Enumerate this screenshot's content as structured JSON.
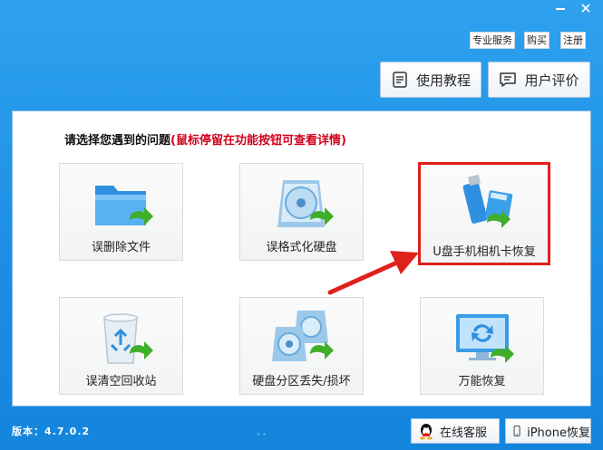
{
  "window": {
    "minimize_glyph": "—",
    "close_glyph": "✕"
  },
  "top_links": {
    "service": "专业服务",
    "buy": "购买",
    "register": "注册"
  },
  "top_buttons": {
    "tutorial": "使用教程",
    "review": "用户评价"
  },
  "main": {
    "prompt": "请选择您遇到的问题",
    "hint": "(鼠标停留在功能按钮可查看详情)",
    "tiles": [
      {
        "label": "误删除文件",
        "icon": "folder-recover-icon"
      },
      {
        "label": "误格式化硬盘",
        "icon": "disk-recover-icon"
      },
      {
        "label": "U盘手机相机卡恢复",
        "icon": "usb-card-recover-icon"
      },
      {
        "label": "误清空回收站",
        "icon": "recycle-bin-recover-icon"
      },
      {
        "label": "硬盘分区丢失/损坏",
        "icon": "partition-recover-icon"
      },
      {
        "label": "万能恢复",
        "icon": "monitor-recover-icon"
      }
    ],
    "highlight_color": "#e0201b"
  },
  "footer": {
    "version": "版本：4.7.0.2",
    "online_service": "在线客服",
    "iphone_recovery": "iPhone恢复"
  },
  "colors": {
    "background": "#1f93e6",
    "accent_green": "#3fae29",
    "icon_blue": "#3a9be8"
  }
}
